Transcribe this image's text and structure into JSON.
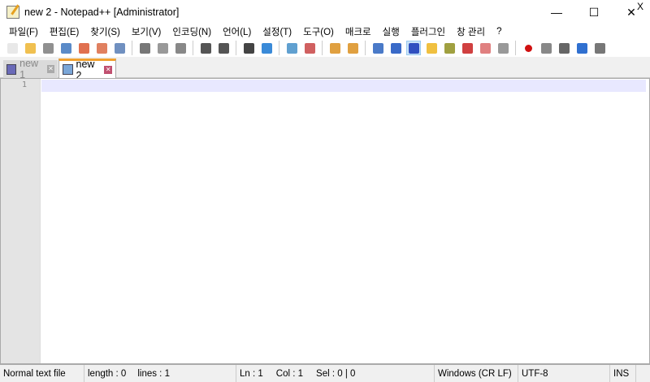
{
  "window": {
    "title": "new 2 - Notepad++ [Administrator]",
    "minimize": "—",
    "maximize": "☐",
    "close": "✕"
  },
  "menu": [
    "파일(F)",
    "편집(E)",
    "찾기(S)",
    "보기(V)",
    "인코딩(N)",
    "언어(L)",
    "설정(T)",
    "도구(O)",
    "매크로",
    "실행",
    "플러그인",
    "창 관리",
    "?"
  ],
  "menu_close": "X",
  "toolbar": [
    {
      "icon": "new-file",
      "color": "#e8e8e8"
    },
    {
      "icon": "open-file",
      "color": "#f0c050"
    },
    {
      "icon": "save",
      "color": "#909090"
    },
    {
      "icon": "save-all",
      "color": "#5a8ac8"
    },
    {
      "icon": "close",
      "color": "#e07050"
    },
    {
      "icon": "close-all",
      "color": "#e08060"
    },
    {
      "icon": "print",
      "color": "#7090c0"
    },
    "sep",
    {
      "icon": "cut",
      "color": "#777"
    },
    {
      "icon": "copy",
      "color": "#999"
    },
    {
      "icon": "paste",
      "color": "#888"
    },
    "sep",
    {
      "icon": "undo",
      "color": "#555"
    },
    {
      "icon": "redo",
      "color": "#555"
    },
    "sep",
    {
      "icon": "find",
      "color": "#444"
    },
    {
      "icon": "replace",
      "color": "#3a8ad8"
    },
    "sep",
    {
      "icon": "zoom-in",
      "color": "#60a0d0"
    },
    {
      "icon": "zoom-out",
      "color": "#d06060"
    },
    "sep",
    {
      "icon": "sync-vertical",
      "color": "#e0a040"
    },
    {
      "icon": "sync-horizontal",
      "color": "#e0a040"
    },
    "sep",
    {
      "icon": "word-wrap",
      "color": "#4a7ac8"
    },
    {
      "icon": "show-all-chars",
      "color": "#3a6ac8"
    },
    {
      "icon": "indent-guide",
      "color": "#3050c0",
      "active": true
    },
    {
      "icon": "udl",
      "color": "#f0c040"
    },
    {
      "icon": "doc-map",
      "color": "#a0a040"
    },
    {
      "icon": "function-list",
      "color": "#d04040"
    },
    {
      "icon": "folder-workspace",
      "color": "#e08080"
    },
    {
      "icon": "monitoring",
      "color": "#999"
    },
    "sep",
    {
      "icon": "record-macro",
      "color": "#d01010"
    },
    {
      "icon": "stop-macro",
      "color": "#888"
    },
    {
      "icon": "play-macro",
      "color": "#666"
    },
    {
      "icon": "play-macro-multiple",
      "color": "#3070d0"
    },
    {
      "icon": "save-macro",
      "color": "#777"
    }
  ],
  "tabs": [
    {
      "label": "new 1",
      "active": false
    },
    {
      "label": "new 2",
      "active": true
    }
  ],
  "editor": {
    "line_numbers": [
      "1"
    ]
  },
  "status": {
    "type": "Normal text file",
    "length": "length : 0",
    "lines": "lines : 1",
    "ln": "Ln : 1",
    "col": "Col : 1",
    "sel": "Sel : 0 | 0",
    "eol": "Windows (CR LF)",
    "encoding": "UTF-8",
    "mode": "INS"
  }
}
